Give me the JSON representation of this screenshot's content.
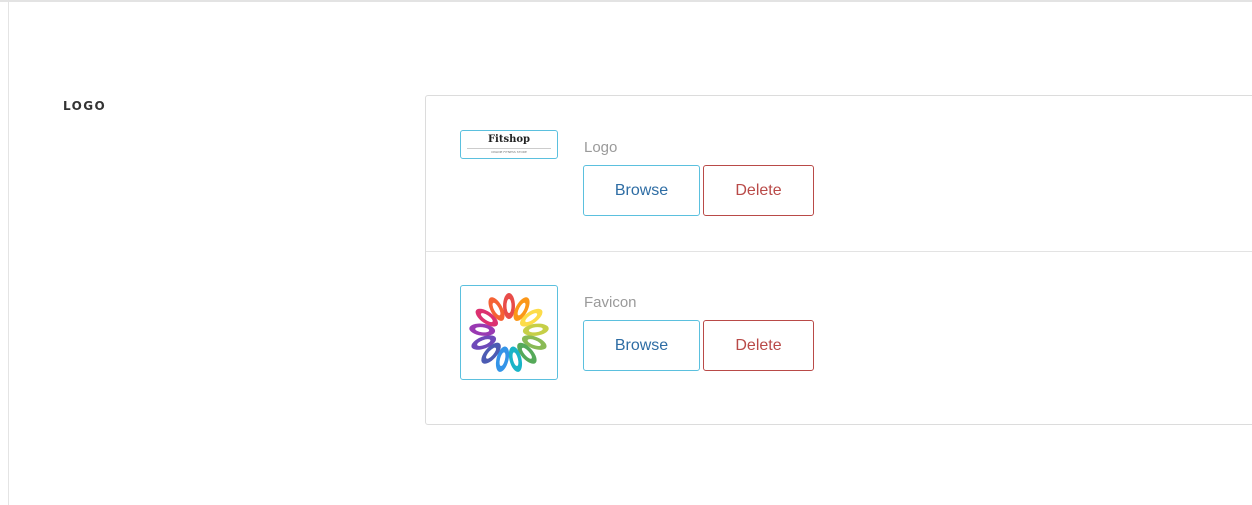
{
  "section": {
    "label": "LOGO"
  },
  "logo": {
    "field_label": "Logo",
    "preview_text": "Fitshop",
    "preview_tagline": "ONLINE FITNESS STORE",
    "browse_label": "Browse",
    "delete_label": "Delete"
  },
  "favicon": {
    "field_label": "Favicon",
    "browse_label": "Browse",
    "delete_label": "Delete"
  },
  "colors": {
    "browse_border": "#5bc0de",
    "browse_text": "#2e6da4",
    "delete_border": "#b94a48",
    "delete_text": "#b94a48"
  }
}
